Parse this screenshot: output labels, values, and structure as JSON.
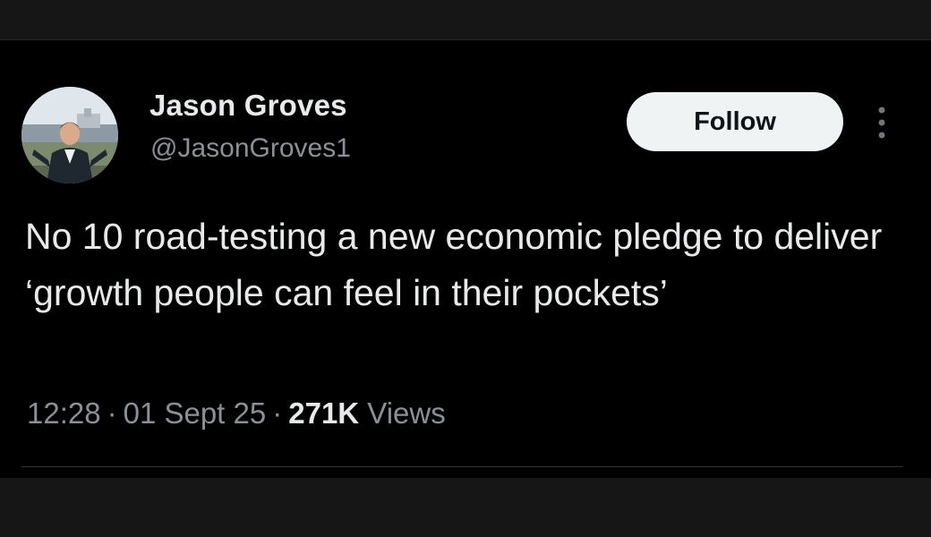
{
  "tweet": {
    "author": {
      "display_name": "Jason Groves",
      "handle": "@JasonGroves1",
      "avatar_icon": "profile-photo"
    },
    "follow_label": "Follow",
    "more_icon": "more-vertical-icon",
    "text": "No 10 road-testing a new economic pledge to deliver ‘growth people can feel in their pockets’",
    "time": "12:28",
    "date": "01 Sept 25",
    "separator": "·",
    "views_count": "271K",
    "views_label": "Views"
  },
  "colors": {
    "background": "#000000",
    "frame": "#161616",
    "primary_text": "#e7e9ea",
    "secondary_text": "#8b9096",
    "follow_button_bg": "#eff3f4",
    "follow_button_text": "#0f1419",
    "divider": "#2f3336"
  }
}
